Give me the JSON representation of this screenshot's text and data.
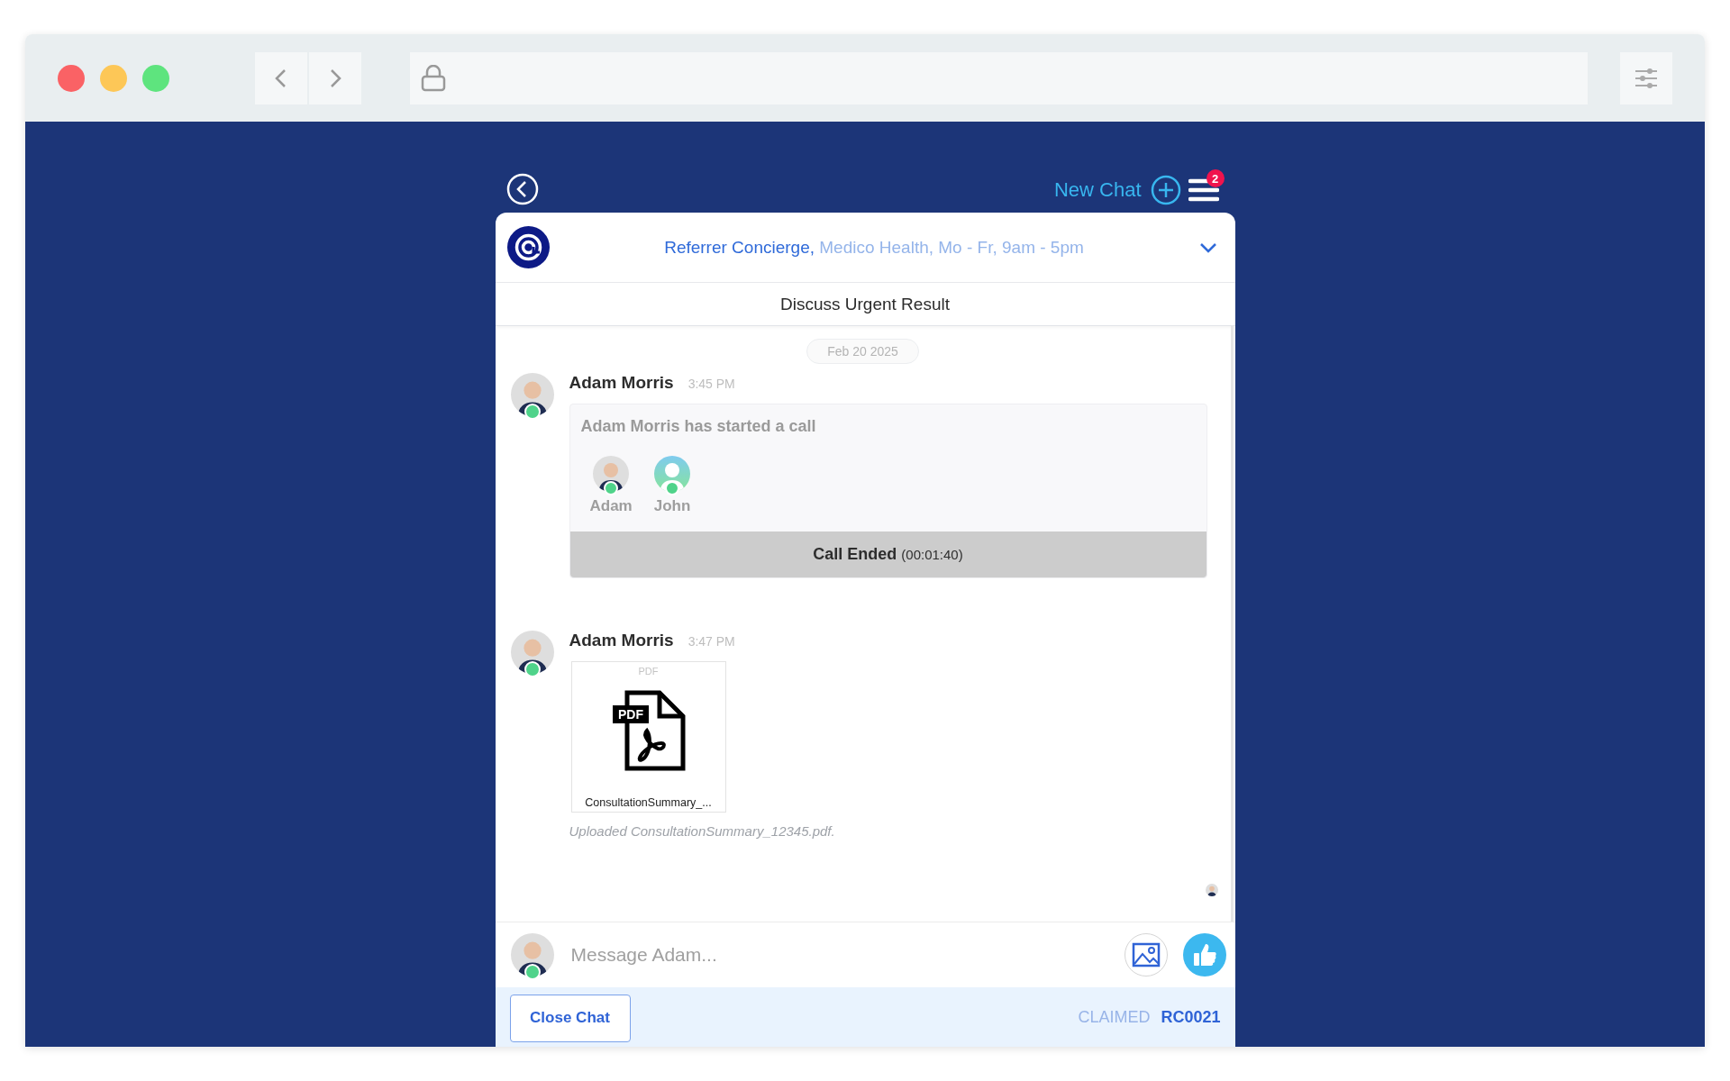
{
  "topbar": {
    "new_chat": "New Chat",
    "badge": "2"
  },
  "header": {
    "agent": "Referrer Concierge,",
    "details": "Medico Health, Mo - Fr, 9am - 5pm"
  },
  "subject": "Discuss Urgent Result",
  "date": "Feb 20 2025",
  "messages": [
    {
      "kind": "call",
      "author": "Adam Morris",
      "time": "3:45 PM",
      "online": true,
      "title": "Adam Morris has started a call",
      "participants": [
        {
          "name": "Adam",
          "kind": "photo"
        },
        {
          "name": "John",
          "kind": "generic"
        }
      ],
      "status": "Call Ended",
      "duration": "(00:01:40)"
    },
    {
      "kind": "file",
      "author": "Adam Morris",
      "time": "3:47 PM",
      "online": true,
      "file_type": "PDF",
      "icon_label": "PDF",
      "file_name": "ConsultationSummary_...",
      "caption": "Uploaded ConsultationSummary_12345.pdf."
    }
  ],
  "composer": {
    "placeholder": "Message Adam...",
    "online": true
  },
  "footer": {
    "button": "Close Chat",
    "status": "CLAIMED",
    "code": "RC0021"
  }
}
